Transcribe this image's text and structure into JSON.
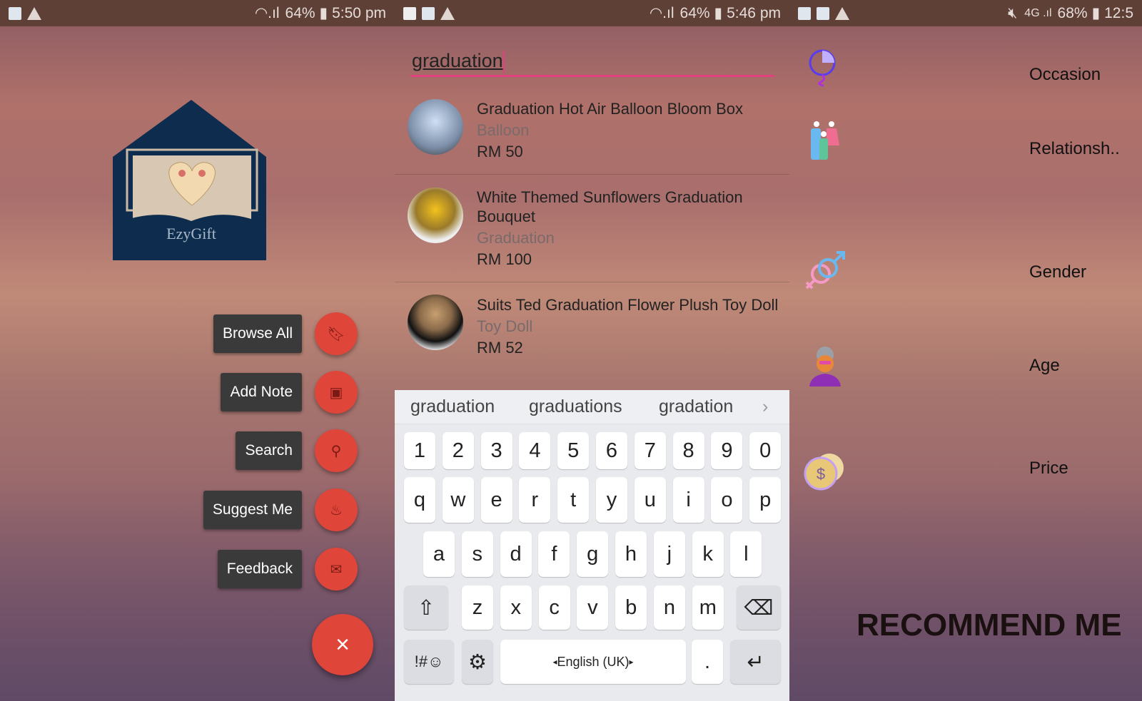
{
  "screens": [
    {
      "status": {
        "battery": "64%",
        "time": "5:50 pm"
      },
      "logo_text": "EzyGift",
      "menu": [
        {
          "label": "Browse All",
          "icon": "bookmark-icon"
        },
        {
          "label": "Add Note",
          "icon": "note-icon"
        },
        {
          "label": "Search",
          "icon": "search-icon"
        },
        {
          "label": "Suggest Me",
          "icon": "gift-hand-icon"
        },
        {
          "label": "Feedback",
          "icon": "mail-open-icon"
        }
      ],
      "close_icon": "×",
      "accent": "#e0453a"
    },
    {
      "status": {
        "battery": "64%",
        "time": "5:46 pm"
      },
      "search": {
        "value": "graduation"
      },
      "results": [
        {
          "title": "Graduation Hot Air Balloon Bloom Box",
          "category": "Balloon",
          "price": "RM 50"
        },
        {
          "title": "White Themed Sunflowers Graduation Bouquet",
          "category": "Graduation",
          "price": "RM 100"
        },
        {
          "title": "Suits Ted Graduation Flower Plush Toy Doll",
          "category": "Toy Doll",
          "price": "RM 52"
        }
      ],
      "keyboard": {
        "suggestions": [
          "graduation",
          "graduations",
          "gradation"
        ],
        "row_numbers": [
          "1",
          "2",
          "3",
          "4",
          "5",
          "6",
          "7",
          "8",
          "9",
          "0"
        ],
        "row1": [
          "q",
          "w",
          "e",
          "r",
          "t",
          "y",
          "u",
          "i",
          "o",
          "p"
        ],
        "row2": [
          "a",
          "s",
          "d",
          "f",
          "g",
          "h",
          "j",
          "k",
          "l"
        ],
        "row3": [
          "z",
          "x",
          "c",
          "v",
          "b",
          "n",
          "m"
        ],
        "symbols": "!#☺",
        "language": "English (UK)",
        "period": "."
      },
      "accent": "#e2407f"
    },
    {
      "status": {
        "battery": "68%",
        "time": "12:5"
      },
      "criteria": [
        {
          "label": "Occasion",
          "icon": "balloon-icon"
        },
        {
          "label": "Relationsh..",
          "icon": "family-icon"
        },
        {
          "label": "Gender",
          "icon": "gender-icon"
        },
        {
          "label": "Age",
          "icon": "grandmother-icon"
        },
        {
          "label": "Price",
          "icon": "coins-icon"
        }
      ],
      "recommend_label": "RECOMMEND ME"
    }
  ]
}
